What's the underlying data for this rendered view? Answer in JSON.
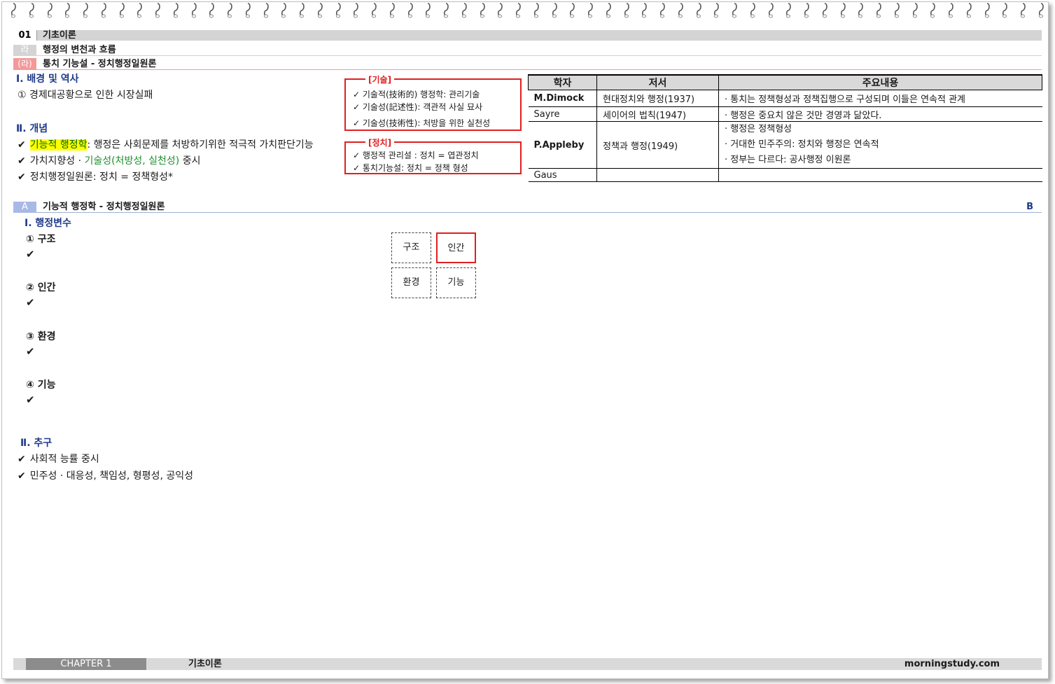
{
  "header": {
    "chapter_num": "01",
    "chapter_title": "기초이론",
    "section_tag": "라",
    "section_title": "행정의 변천과 흐름",
    "sub_tag": "(라)",
    "sub_title": "통치 기능설 - 정치행정일원론"
  },
  "intro": {
    "h1": "Ⅰ. 배경 및 역사",
    "item1": "① 경제대공황으로 인한 시장실패",
    "h2": "Ⅱ. 개념",
    "c1_hl": "기능적 행정학",
    "c1_rest": ": 행정은 사회문제를 처방하기위한 적극적 가치판단기능",
    "c2_a": "가치지향성 · ",
    "c2_green": "기술성(처방성, 실천성)",
    "c2_b": " 중시",
    "c3": "정치행정일원론: 정치 = 정책형성*",
    "check": "✔"
  },
  "box_tech": {
    "caption": "[기술]",
    "rows": [
      "✓ 기술적(技術的) 행정학: 관리기술",
      "✓ 기술성(記述性): 객관적 사실 묘사",
      "✓ 기술성(技術性): 처방을 위한 실천성"
    ]
  },
  "box_pol": {
    "caption": "[정치]",
    "rows": [
      "✓ 행정적 관리설 : 정치 = 엽관정치",
      "✓ 통치기능설: 정치 = 정책 형성"
    ]
  },
  "table": {
    "headers": [
      "학자",
      "저서",
      "주요내용"
    ],
    "rows": [
      {
        "scholar": "M.Dimock",
        "book": "현대정치와 행정(1937)",
        "content": [
          "· 통치는 정책형성과 정책집행으로 구성되며 이들은 연속적 관계"
        ]
      },
      {
        "scholar": "Sayre",
        "book": "세이어의 법칙(1947)",
        "content": [
          "· 행정은 중요치 않은 것만 경영과 닮았다."
        ]
      },
      {
        "scholar": "P.Appleby",
        "book": "정책과 행정(1949)",
        "content": [
          "· 행정은 정책형성",
          "· 거대한 민주주의: 정치와 행정은 연속적",
          "· 정부는 다르다: 공사행정 이원론"
        ]
      },
      {
        "scholar": "Gaus",
        "book": "",
        "content": [
          ""
        ]
      }
    ]
  },
  "sectionA": {
    "tag": "A",
    "title": "기능적 행정학 - 정치행정일원론",
    "right": "B",
    "h1": "Ⅰ. 행정변수",
    "vars": [
      "① 구조",
      "② 인간",
      "③ 환경",
      "④ 기능"
    ],
    "boxes": [
      "구조",
      "인간",
      "환경",
      "기능"
    ],
    "h2": "Ⅱ. 추구",
    "p1": "사회적 능률 중시",
    "p2": "민주성 · 대응성, 책임성, 형평성, 공익성"
  },
  "footer": {
    "chapter": "CHAPTER 1",
    "title": "기초이론",
    "site": "morningstudy.com"
  }
}
